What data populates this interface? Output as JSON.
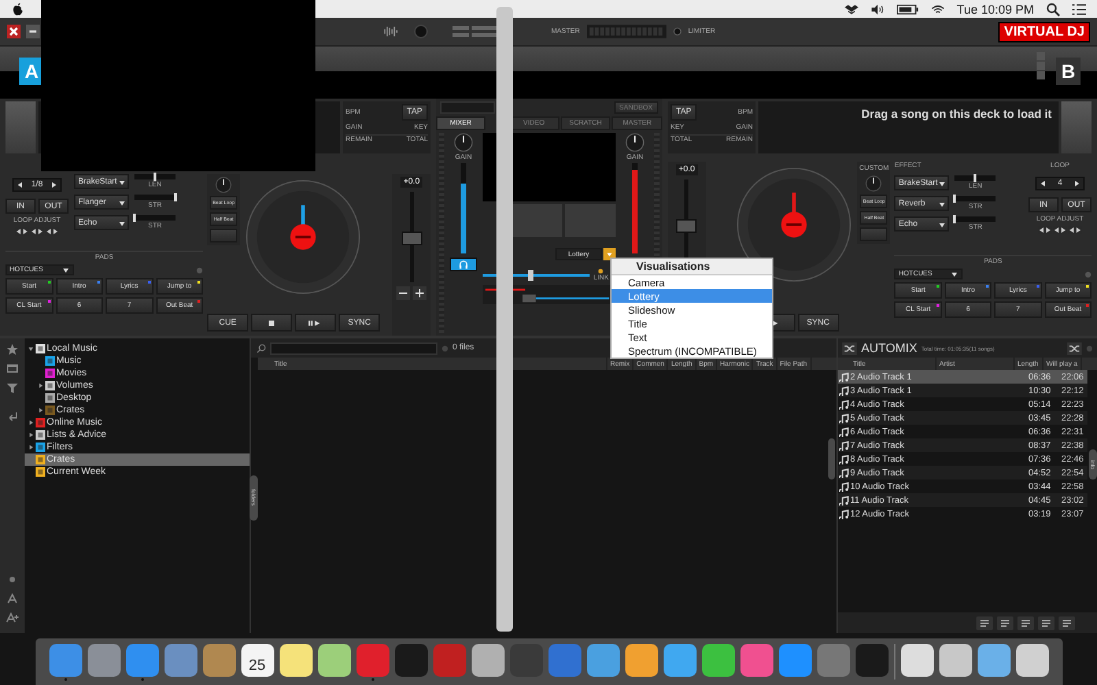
{
  "menu_bar": {
    "clock": "Tue 10:09 PM"
  },
  "top_bar": {
    "master_label": "MASTER",
    "limiter_label": "LIMITER",
    "logo": "VIRTUAL DJ"
  },
  "decks": [
    {
      "letter": "A",
      "color": "#1ea0e6",
      "info": {
        "bpm": "BPM",
        "tap": "TAP",
        "gain": "GAIN",
        "key": "KEY",
        "remain": "REMAIN",
        "total": "TOTAL"
      },
      "loop": {
        "size": "1/8",
        "in": "IN",
        "out": "OUT",
        "adjust": "LOOP ADJUST"
      },
      "effects": [
        {
          "name": "BrakeStart",
          "slider": "LEN",
          "level": 0.5
        },
        {
          "name": "Flanger",
          "slider": "STR",
          "level": 1.0
        },
        {
          "name": "Echo",
          "slider": "STR",
          "level": 0.0
        }
      ],
      "side_buttons": [
        "Beat Loop",
        "Half Beat"
      ],
      "pads_header": "PADS",
      "pad_mode": "HOTCUES",
      "pads": [
        {
          "label": "Start",
          "color": "#22cc22"
        },
        {
          "label": "Intro",
          "color": "#3a7ff0"
        },
        {
          "label": "Lyrics",
          "color": "#3a5ff0"
        },
        {
          "label": "Jump to",
          "color": "#f0e020"
        },
        {
          "label": "CL Start",
          "color": "#e020e0"
        },
        {
          "label": "6"
        },
        {
          "label": "7"
        },
        {
          "label": "Out Beat",
          "color": "#e02020"
        }
      ],
      "pitch": {
        "reading": "+0.0",
        "level": 0.5
      },
      "transport": {
        "cue": "CUE",
        "sync": "SYNC"
      }
    },
    {
      "letter": "B",
      "color": "#e01818",
      "message": "Drag a song on this deck to load it",
      "info": {
        "bpm": "BPM",
        "tap": "TAP",
        "gain": "GAIN",
        "key": "KEY",
        "remain": "REMAIN",
        "total": "TOTAL"
      },
      "effect_header": "EFFECT",
      "loop_header": "LOOP",
      "custom_label": "CUSTOM",
      "loop": {
        "size": "4",
        "in": "IN",
        "out": "OUT",
        "adjust": "LOOP ADJUST"
      },
      "effects": [
        {
          "name": "BrakeStart",
          "slider": "LEN",
          "level": 0.5
        },
        {
          "name": "Reverb",
          "slider": "STR",
          "level": 0.0
        },
        {
          "name": "Echo",
          "slider": "STR",
          "level": 0.0
        }
      ],
      "side_buttons": [
        "Beat Loop",
        "Half Beat"
      ],
      "pads_header": "PADS",
      "pad_mode": "HOTCUES",
      "pads": [
        {
          "label": "Start",
          "color": "#22cc22"
        },
        {
          "label": "Intro",
          "color": "#3a7ff0"
        },
        {
          "label": "Lyrics",
          "color": "#3a5ff0"
        },
        {
          "label": "Jump to",
          "color": "#f0e020"
        },
        {
          "label": "CL Start",
          "color": "#e020e0"
        },
        {
          "label": "6"
        },
        {
          "label": "7"
        },
        {
          "label": "Out Beat",
          "color": "#e02020"
        }
      ],
      "pitch": {
        "reading": "+0.0",
        "level": 0.5
      },
      "transport": {
        "sync": "SYNC"
      }
    }
  ],
  "mixer": {
    "sandbox": "SANDBOX",
    "tabs": [
      {
        "label": "MIXER",
        "selected": true
      },
      {
        "label": "VIDEO",
        "selected": false
      },
      {
        "label": "SCRATCH",
        "selected": false
      },
      {
        "label": "MASTER",
        "selected": false
      }
    ],
    "channels": [
      {
        "gain_label": "GAIN",
        "level": 0.78,
        "color": "#1e9be0"
      },
      {
        "gain_label": "GAIN",
        "level": 0.92,
        "color": "#e01818"
      }
    ],
    "headphones_a_on": true,
    "video_fx": "Lottery",
    "link_label": "LINK",
    "crossfader": {
      "level": 0.45
    }
  },
  "visualisations_menu": {
    "title": "Visualisations",
    "items": [
      {
        "label": "Camera",
        "selected": false
      },
      {
        "label": "Lottery",
        "selected": true
      },
      {
        "label": "Slideshow",
        "selected": false
      },
      {
        "label": "Title",
        "selected": false
      },
      {
        "label": "Text",
        "selected": false
      },
      {
        "label": "Spectrum (INCOMPATIBLE)",
        "selected": false
      }
    ]
  },
  "browser": {
    "tree": [
      {
        "label": "Local Music",
        "color": "#dddddd",
        "expandable": true,
        "expanded": true,
        "selected": false,
        "children": [
          {
            "label": "Music",
            "color": "#1aa3e8",
            "expandable": false,
            "selected": false
          },
          {
            "label": "Movies",
            "color": "#e020d0",
            "expandable": false,
            "selected": false
          },
          {
            "label": "Volumes",
            "color": "#cccccc",
            "expandable": true,
            "expanded": false,
            "selected": false
          },
          {
            "label": "Desktop",
            "color": "#aaaaaa",
            "expandable": false,
            "selected": false
          },
          {
            "label": "Crates",
            "color": "#7a5a20",
            "expandable": true,
            "expanded": false,
            "selected": false
          }
        ]
      },
      {
        "label": "Online Music",
        "color": "#e02020",
        "expandable": true,
        "expanded": false,
        "selected": false
      },
      {
        "label": "Lists & Advice",
        "color": "#cccccc",
        "expandable": true,
        "expanded": false,
        "selected": false
      },
      {
        "label": "Filters",
        "color": "#1aa3e8",
        "expandable": true,
        "expanded": false,
        "selected": false
      },
      {
        "label": "Crates",
        "color": "#f0b020",
        "expandable": false,
        "selected": true
      },
      {
        "label": "Current Week",
        "color": "#f0b020",
        "expandable": false,
        "selected": false
      }
    ],
    "folders_tab": "folders",
    "file_count": "0 files",
    "columns": [
      "Title",
      "Remix",
      "Commen",
      "Length",
      "Bpm",
      "Harmonic",
      "Track",
      "File Path"
    ]
  },
  "automix": {
    "title": "AUTOMIX",
    "total": "Total time: 01:05:35(11 songs)",
    "columns": [
      "Title",
      "Artist",
      "Length",
      "Will play a"
    ],
    "info_tab": "info",
    "rows": [
      {
        "title": "2 Audio Track 1",
        "length": "06:36",
        "play_at": "22:06",
        "selected": true
      },
      {
        "title": "3 Audio Track 1",
        "length": "10:30",
        "play_at": "22:12",
        "selected": false
      },
      {
        "title": "4 Audio Track",
        "length": "05:14",
        "play_at": "22:23",
        "selected": false
      },
      {
        "title": "5 Audio Track",
        "length": "03:45",
        "play_at": "22:28",
        "selected": false
      },
      {
        "title": "6 Audio Track",
        "length": "06:36",
        "play_at": "22:31",
        "selected": false
      },
      {
        "title": "7 Audio Track",
        "length": "08:37",
        "play_at": "22:38",
        "selected": false
      },
      {
        "title": "8 Audio Track",
        "length": "07:36",
        "play_at": "22:46",
        "selected": false
      },
      {
        "title": "9 Audio Track",
        "length": "04:52",
        "play_at": "22:54",
        "selected": false
      },
      {
        "title": "10 Audio Track",
        "length": "03:44",
        "play_at": "22:58",
        "selected": false
      },
      {
        "title": "11 Audio Track",
        "length": "04:45",
        "play_at": "23:02",
        "selected": false
      },
      {
        "title": "12 Audio Track",
        "length": "03:19",
        "play_at": "23:07",
        "selected": false
      }
    ]
  },
  "dock": {
    "apps": [
      {
        "color": "#3d8fe6",
        "running": true
      },
      {
        "color": "#8a8f98",
        "running": false
      },
      {
        "color": "#2f8ff0",
        "running": true
      },
      {
        "color": "#6a8fc0",
        "running": false
      },
      {
        "color": "#b08850",
        "running": false
      },
      {
        "color": "#f4f4f4",
        "running": false,
        "label": "25"
      },
      {
        "color": "#f5e27a",
        "running": false
      },
      {
        "color": "#9ccf7a",
        "running": false
      },
      {
        "color": "#e0202c",
        "running": true
      },
      {
        "color": "#1a1a1a",
        "running": false
      },
      {
        "color": "#c02020",
        "running": false
      },
      {
        "color": "#b0b0b0",
        "running": false
      },
      {
        "color": "#3a3a3a",
        "running": false
      },
      {
        "color": "#3070d0",
        "running": false
      },
      {
        "color": "#4aa0e0",
        "running": false
      },
      {
        "color": "#f0a030",
        "running": false
      },
      {
        "color": "#40a8f0",
        "running": false
      },
      {
        "color": "#3cc040",
        "running": false
      },
      {
        "color": "#f05090",
        "running": false
      },
      {
        "color": "#1e90ff",
        "running": false
      },
      {
        "color": "#777777",
        "running": false
      },
      {
        "color": "#1a1a1a",
        "running": false
      }
    ],
    "files": [
      {
        "color": "#dddddd"
      },
      {
        "color": "#c8c8c8"
      },
      {
        "color": "#6ab0e8"
      },
      {
        "color": "#d0d0d0"
      }
    ]
  }
}
